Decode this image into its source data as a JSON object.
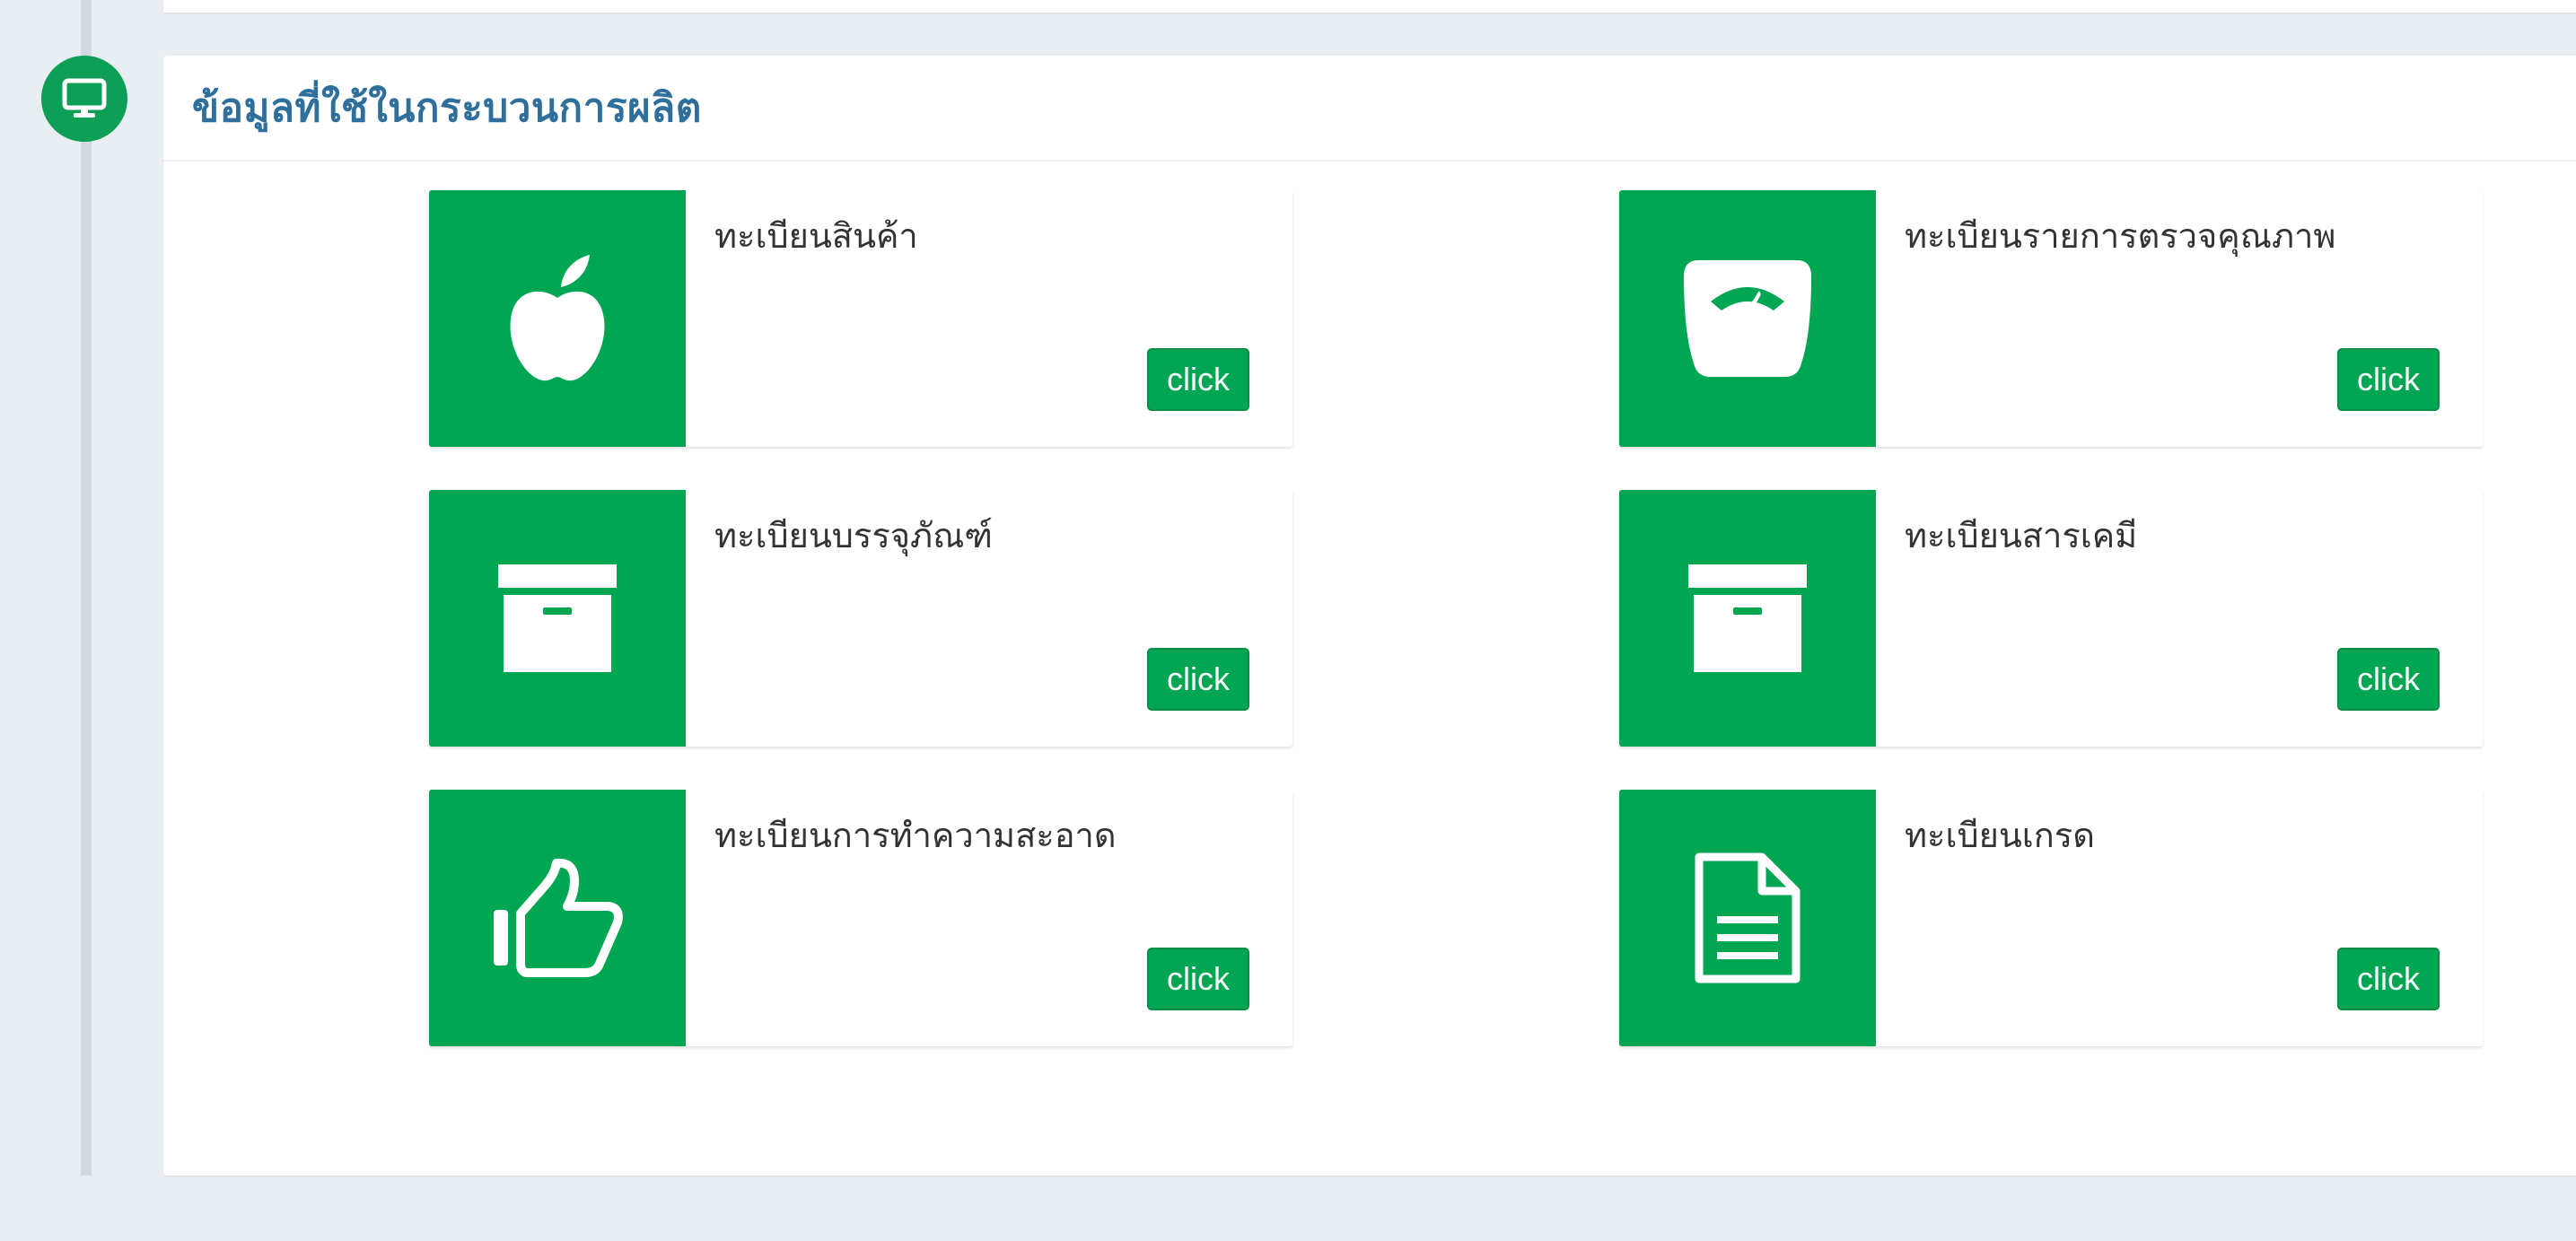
{
  "section": {
    "title": "ข้อมูลที่ใช้ในกระบวนการผลิต"
  },
  "colors": {
    "accent": "#00a651",
    "badge": "#0d9f55",
    "title": "#2e6f9c",
    "background": "#e9eef2"
  },
  "cards": [
    {
      "label": "ทะเบียนสินค้า",
      "button": "click",
      "icon": "apple-icon"
    },
    {
      "label": "ทะเบียนรายการตรวจคุณภาพ",
      "button": "click",
      "icon": "scale-icon"
    },
    {
      "label": "ทะเบียนบรรจุภัณฑ์",
      "button": "click",
      "icon": "archive-icon"
    },
    {
      "label": "ทะเบียนสารเคมี",
      "button": "click",
      "icon": "archive-icon"
    },
    {
      "label": "ทะเบียนการทำความสะอาด",
      "button": "click",
      "icon": "thumbs-up-icon"
    },
    {
      "label": "ทะเบียนเกรด",
      "button": "click",
      "icon": "document-icon"
    }
  ]
}
